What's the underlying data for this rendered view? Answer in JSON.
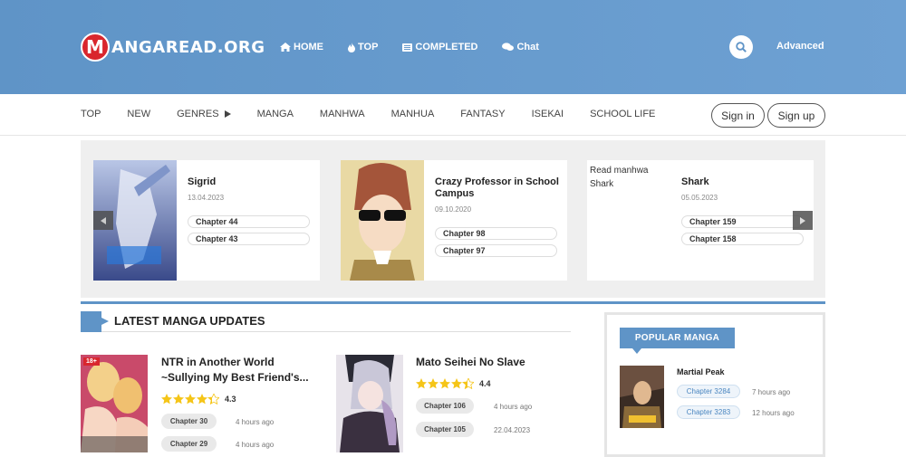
{
  "header": {
    "logo_letter": "M",
    "logo_text": "ANGAREAD.ORG",
    "nav": [
      {
        "label": "HOME",
        "icon": "home-icon"
      },
      {
        "label": "TOP",
        "icon": "fire-icon"
      },
      {
        "label": "COMPLETED",
        "icon": "list-icon"
      },
      {
        "label": "Chat",
        "icon": "chat-icon"
      }
    ],
    "advanced": "Advanced"
  },
  "subnav": {
    "links": [
      "TOP",
      "NEW",
      "GENRES",
      "MANGA",
      "MANHWA",
      "MANHUA",
      "FANTASY",
      "ISEKAI",
      "SCHOOL LIFE"
    ],
    "sign_in": "Sign in",
    "sign_up": "Sign up"
  },
  "slider": [
    {
      "title": "Sigrid",
      "date": "13.04.2023",
      "chapters": [
        "Chapter 44",
        "Chapter 43"
      ]
    },
    {
      "title": "Crazy Professor in School Campus",
      "date": "09.10.2020",
      "chapters": [
        "Chapter 98",
        "Chapter 97"
      ]
    },
    {
      "alt": "Read manhwa Shark",
      "title": "Shark",
      "date": "05.05.2023",
      "chapters": [
        "Chapter 159",
        "Chapter 158"
      ]
    }
  ],
  "latest": {
    "heading": "LATEST MANGA UPDATES",
    "items": [
      {
        "title_1": "NTR in Another World",
        "title_2": "~Sullying My Best Friend's...",
        "badge": "18+",
        "rating": "4.3",
        "stars": 4.3,
        "chapters": [
          {
            "name": "Chapter 30",
            "time": "4 hours ago"
          },
          {
            "name": "Chapter 29",
            "time": "4 hours ago"
          }
        ]
      },
      {
        "title_1": "Mato Seihei No Slave",
        "rating": "4.4",
        "stars": 4.4,
        "chapters": [
          {
            "name": "Chapter 106",
            "time": "4 hours ago"
          },
          {
            "name": "Chapter 105",
            "time": "22.04.2023"
          }
        ]
      }
    ]
  },
  "popular": {
    "heading": "POPULAR MANGA",
    "items": [
      {
        "title": "Martial Peak",
        "chapters": [
          {
            "name": "Chapter 3284",
            "time": "7 hours ago"
          },
          {
            "name": "Chapter 3283",
            "time": "12 hours ago"
          }
        ]
      }
    ]
  },
  "colors": {
    "header": "#6a9cce",
    "accent": "#5f94c7",
    "logo_red": "#d9262d",
    "star": "#f5c518"
  }
}
